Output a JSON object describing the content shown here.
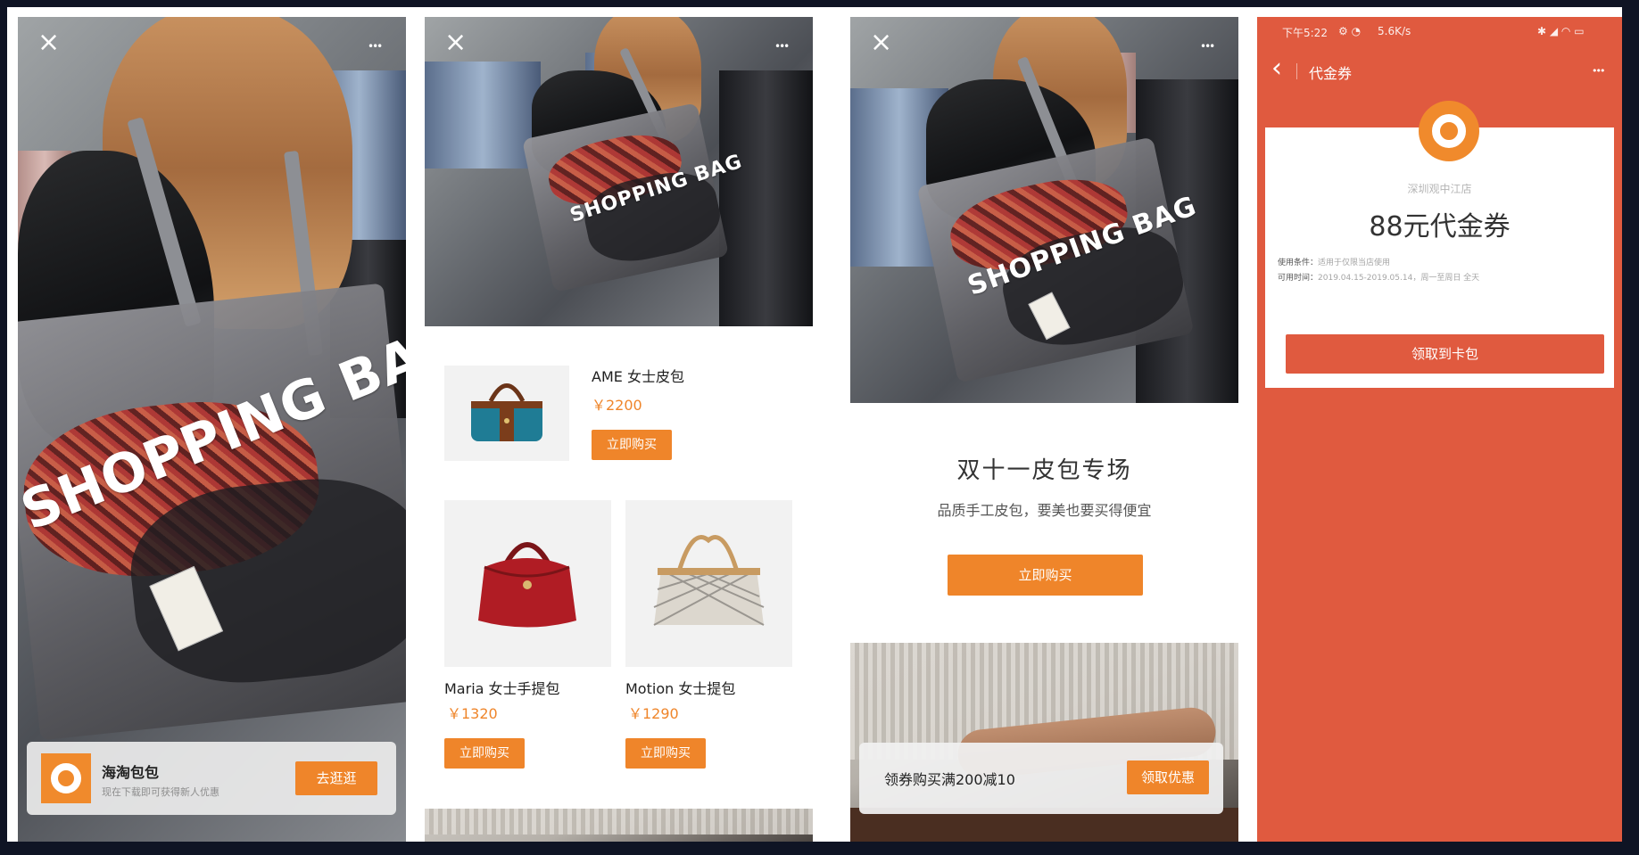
{
  "colors": {
    "accent": "#ef852a",
    "coupon_red": "#e05a3f",
    "background": "#0f1424"
  },
  "panel1": {
    "close_icon": "×",
    "more_icon": "•••",
    "bag_print": "SHOPPING BAG",
    "banner": {
      "title": "海淘包包",
      "subtitle": "现在下载即可获得新人优惠",
      "button": "去逛逛"
    }
  },
  "panel2": {
    "close_icon": "×",
    "more_icon": "•••",
    "bag_print": "SHOPPING BAG",
    "featured": {
      "name": "AME 女士皮包",
      "price": "￥2200",
      "button": "立即购买"
    },
    "products": [
      {
        "name": "Maria 女士手提包",
        "price": "￥1320",
        "button": "立即购买"
      },
      {
        "name": "Motion 女士提包",
        "price": "￥1290",
        "button": "立即购买"
      }
    ]
  },
  "panel3": {
    "close_icon": "×",
    "more_icon": "•••",
    "bag_print": "SHOPPING BAG",
    "title": "双十一皮包专场",
    "subtitle": "品质手工皮包，要美也要买得便宜",
    "button": "立即购买",
    "banner": {
      "text": "领券购买满200减10",
      "button": "领取优惠"
    }
  },
  "panel4": {
    "status_time": "下午5:22",
    "status_speed": "5.6K/s",
    "status_icons": "⚙ ◔",
    "signal_icons": "✱ ◢ ◠ ▭",
    "back_icon": "‹",
    "title": "代金券",
    "more_icon": "•••",
    "store_name": "深圳观中江店",
    "coupon_title": "88元代金券",
    "usage_label": "使用条件：",
    "usage_value": "适用于仅限当店使用",
    "valid_label": "可用时间：",
    "valid_value": "2019.04.15-2019.05.14，周一至周日 全天",
    "button": "领取到卡包"
  }
}
